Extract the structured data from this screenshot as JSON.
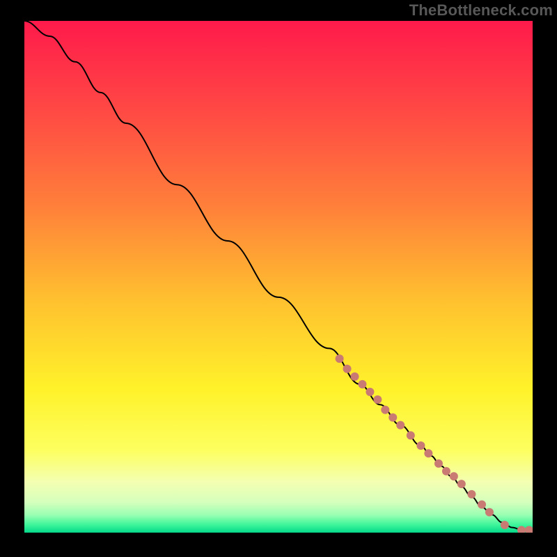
{
  "watermark": "TheBottleneck.com",
  "chart_data": {
    "type": "line",
    "title": "",
    "xlabel": "",
    "ylabel": "",
    "xlim": [
      0,
      100
    ],
    "ylim": [
      0,
      100
    ],
    "grid": false,
    "legend": false,
    "background": {
      "type": "vertical-gradient",
      "stops": [
        {
          "pos": 0.0,
          "color": "#ff1a4b"
        },
        {
          "pos": 0.18,
          "color": "#ff4a44"
        },
        {
          "pos": 0.36,
          "color": "#ff7f3a"
        },
        {
          "pos": 0.55,
          "color": "#ffc22f"
        },
        {
          "pos": 0.72,
          "color": "#fff22a"
        },
        {
          "pos": 0.84,
          "color": "#fdff60"
        },
        {
          "pos": 0.9,
          "color": "#f4ffb1"
        },
        {
          "pos": 0.94,
          "color": "#d6ffbd"
        },
        {
          "pos": 0.965,
          "color": "#9bffb3"
        },
        {
          "pos": 0.985,
          "color": "#3cf59a"
        },
        {
          "pos": 1.0,
          "color": "#05d889"
        }
      ]
    },
    "series": [
      {
        "name": "curve",
        "type": "line",
        "color": "#000000",
        "width": 2,
        "points": [
          {
            "x": 0,
            "y": 100
          },
          {
            "x": 5,
            "y": 97
          },
          {
            "x": 10,
            "y": 92
          },
          {
            "x": 15,
            "y": 86
          },
          {
            "x": 20,
            "y": 80
          },
          {
            "x": 30,
            "y": 68
          },
          {
            "x": 40,
            "y": 57
          },
          {
            "x": 50,
            "y": 46
          },
          {
            "x": 60,
            "y": 36
          },
          {
            "x": 66,
            "y": 29
          },
          {
            "x": 70,
            "y": 25
          },
          {
            "x": 74,
            "y": 21
          },
          {
            "x": 78,
            "y": 17
          },
          {
            "x": 80,
            "y": 15
          },
          {
            "x": 82,
            "y": 13
          },
          {
            "x": 84,
            "y": 11
          },
          {
            "x": 86,
            "y": 9
          },
          {
            "x": 88,
            "y": 7
          },
          {
            "x": 90,
            "y": 5
          },
          {
            "x": 92,
            "y": 3.5
          },
          {
            "x": 94,
            "y": 2
          },
          {
            "x": 96,
            "y": 1
          },
          {
            "x": 98,
            "y": 0.5
          },
          {
            "x": 100,
            "y": 0.5
          }
        ]
      },
      {
        "name": "markers",
        "type": "scatter",
        "color": "#c97a73",
        "radius": 6,
        "points": [
          {
            "x": 62,
            "y": 34
          },
          {
            "x": 63.5,
            "y": 32
          },
          {
            "x": 65,
            "y": 30.5
          },
          {
            "x": 66.5,
            "y": 29
          },
          {
            "x": 68,
            "y": 27.5
          },
          {
            "x": 69.5,
            "y": 26
          },
          {
            "x": 71,
            "y": 24
          },
          {
            "x": 72.5,
            "y": 22.5
          },
          {
            "x": 74,
            "y": 21
          },
          {
            "x": 76,
            "y": 19
          },
          {
            "x": 78,
            "y": 17
          },
          {
            "x": 79.5,
            "y": 15.5
          },
          {
            "x": 81.5,
            "y": 13.5
          },
          {
            "x": 83,
            "y": 12
          },
          {
            "x": 84.5,
            "y": 11
          },
          {
            "x": 86,
            "y": 9.5
          },
          {
            "x": 88,
            "y": 7.5
          },
          {
            "x": 90,
            "y": 5.5
          },
          {
            "x": 91.5,
            "y": 4
          },
          {
            "x": 94.5,
            "y": 1.5
          },
          {
            "x": 97.8,
            "y": 0.5
          },
          {
            "x": 99.3,
            "y": 0.5
          }
        ]
      }
    ]
  },
  "colors": {
    "marker": "#c97a73",
    "line": "#000000",
    "watermark": "#585858",
    "page_bg": "#000000"
  }
}
